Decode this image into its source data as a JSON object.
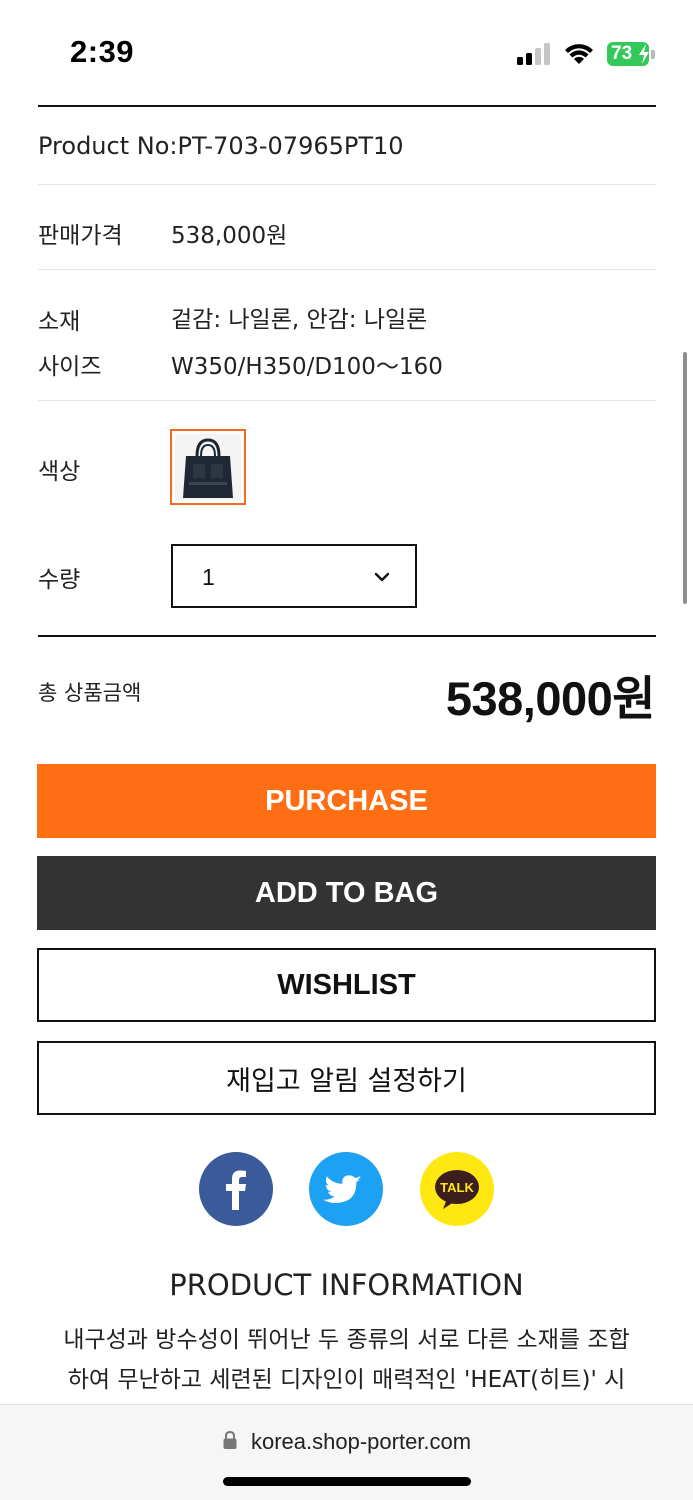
{
  "status_bar": {
    "time": "2:39",
    "battery_level": "73",
    "battery_color": "#34c759"
  },
  "product": {
    "product_no": "Product No:PT-703-07965PT10",
    "price_label": "판매가격",
    "price_value": "538,000원",
    "material_label": "소재",
    "material_value": "겉감: 나일론, 안감: 나일론",
    "size_label": "사이즈",
    "size_value": "W350/H350/D100～160",
    "color_label": "색상",
    "color_swatch_border": "#f26b21",
    "quantity_label": "수량",
    "quantity_value": "1"
  },
  "total": {
    "label": "총 상품금액",
    "value": "538,000원"
  },
  "actions": {
    "purchase": "PURCHASE",
    "add_to_bag": "ADD TO BAG",
    "wishlist": "WISHLIST",
    "restock_alert": "재입고 알림 설정하기",
    "purchase_color": "#ff6e12",
    "bag_color": "#333333"
  },
  "share": {
    "facebook_icon": "facebook-icon",
    "twitter_icon": "twitter-icon",
    "kakaotalk_icon": "kakaotalk-icon",
    "kakaotalk_label": "TALK"
  },
  "info": {
    "title": "PRODUCT INFORMATION",
    "line1": "내구성과 방수성이 뛰어난 두 종류의 서로 다른 소재를 조합",
    "line2": "하여 무난하고 세련된 디자인이 매력적인 'HEAT(히트)' 시"
  },
  "browser": {
    "url": "korea.shop-porter.com"
  }
}
